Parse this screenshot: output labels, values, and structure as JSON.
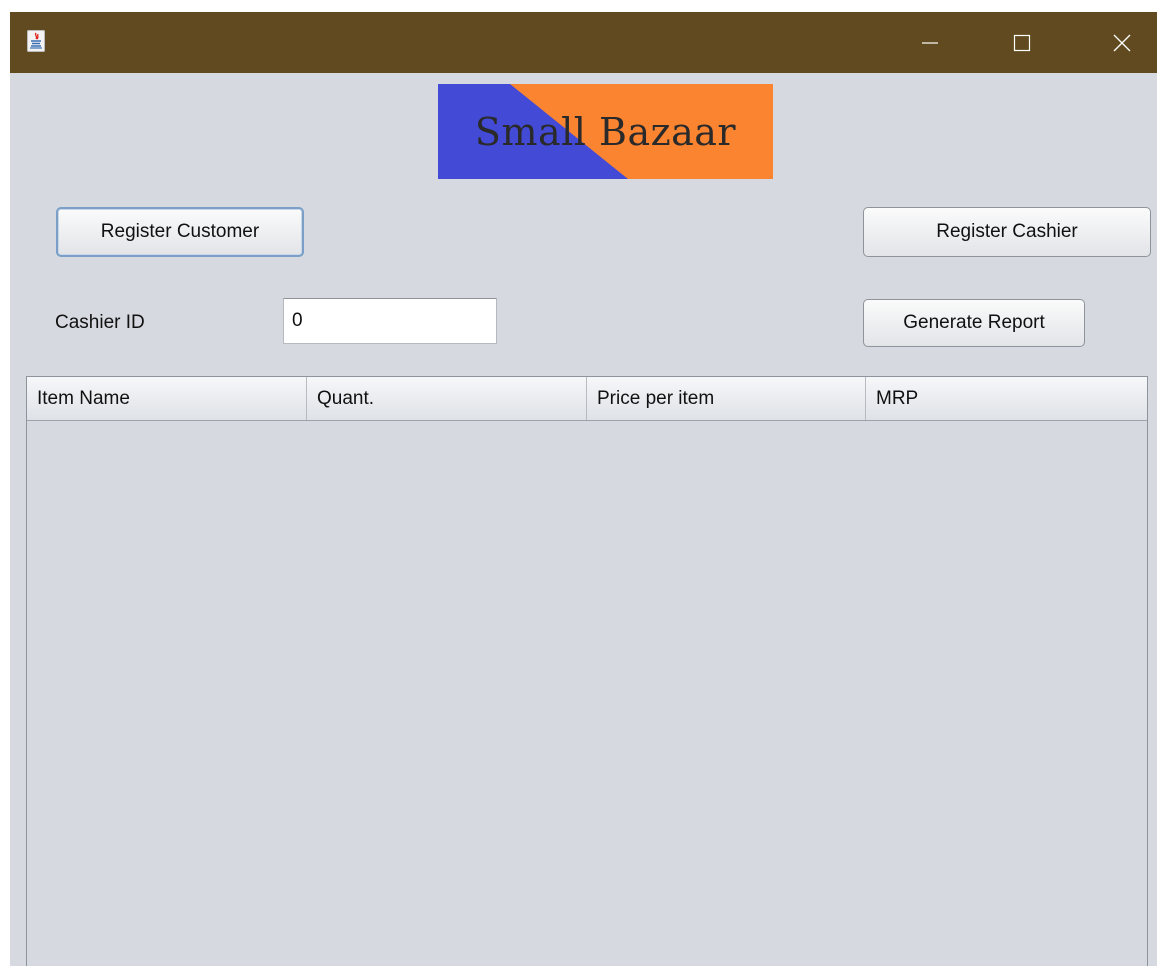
{
  "window": {
    "title": "",
    "controls": {
      "minimize_icon": "minimize-icon",
      "maximize_icon": "maximize-icon",
      "close_icon": "close-icon"
    }
  },
  "banner": {
    "text": "Small Bazaar",
    "colors": {
      "left": "#434bd6",
      "right": "#fb8430"
    }
  },
  "buttons": {
    "register_customer": "Register Customer",
    "register_cashier": "Register Cashier",
    "generate_report": "Generate Report"
  },
  "cashier": {
    "label": "Cashier ID",
    "value": "0"
  },
  "table": {
    "columns": [
      "Item Name",
      "Quant.",
      "Price per item",
      "MRP"
    ],
    "rows": []
  },
  "colors": {
    "titlebar": "#614a1f",
    "background": "#d6d9e0"
  }
}
